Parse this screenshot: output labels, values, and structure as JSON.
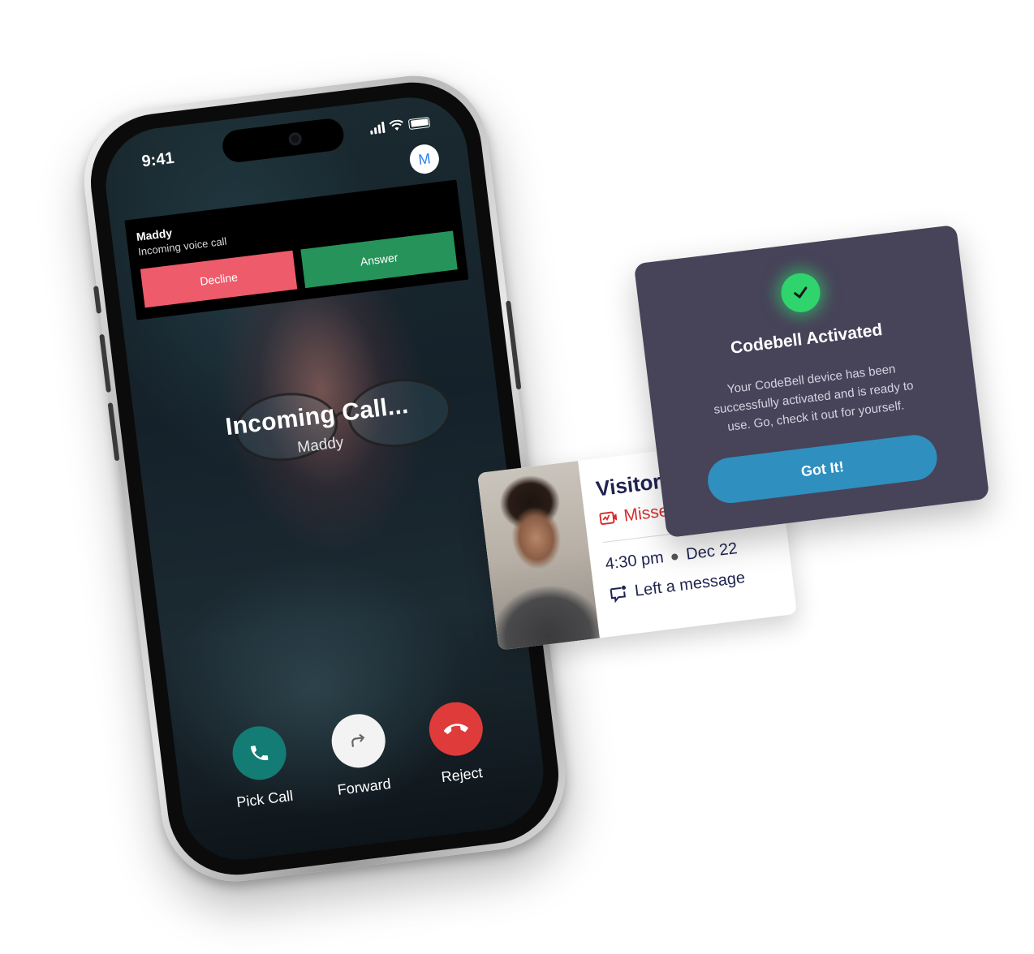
{
  "phone": {
    "status_time": "9:41",
    "avatar_initial": "M",
    "notification": {
      "caller": "Maddy",
      "subtitle": "Incoming voice call",
      "decline_label": "Decline",
      "answer_label": "Answer"
    },
    "incoming_title": "Incoming Call...",
    "incoming_name": "Maddy",
    "actions": {
      "pick_label": "Pick Call",
      "forward_label": "Forward",
      "reject_label": "Reject"
    }
  },
  "visitor_card": {
    "title": "Visitor - Ho",
    "status": "Missed call",
    "time": "4:30 pm",
    "date": "Dec 22",
    "message": "Left a message"
  },
  "activated_card": {
    "title": "Codebell Activated",
    "description": "Your CodeBell device has been successfully activated and is ready to use. Go, check it out for yourself.",
    "button_label": "Got It!"
  },
  "colors": {
    "decline": "#ee5b6b",
    "answer": "#26935a",
    "pick": "#137c74",
    "reject": "#e03b3b",
    "card_dark": "#474359",
    "got_it": "#2f8fbf",
    "check_green": "#2fd46c",
    "missed_red": "#d32f2f"
  }
}
